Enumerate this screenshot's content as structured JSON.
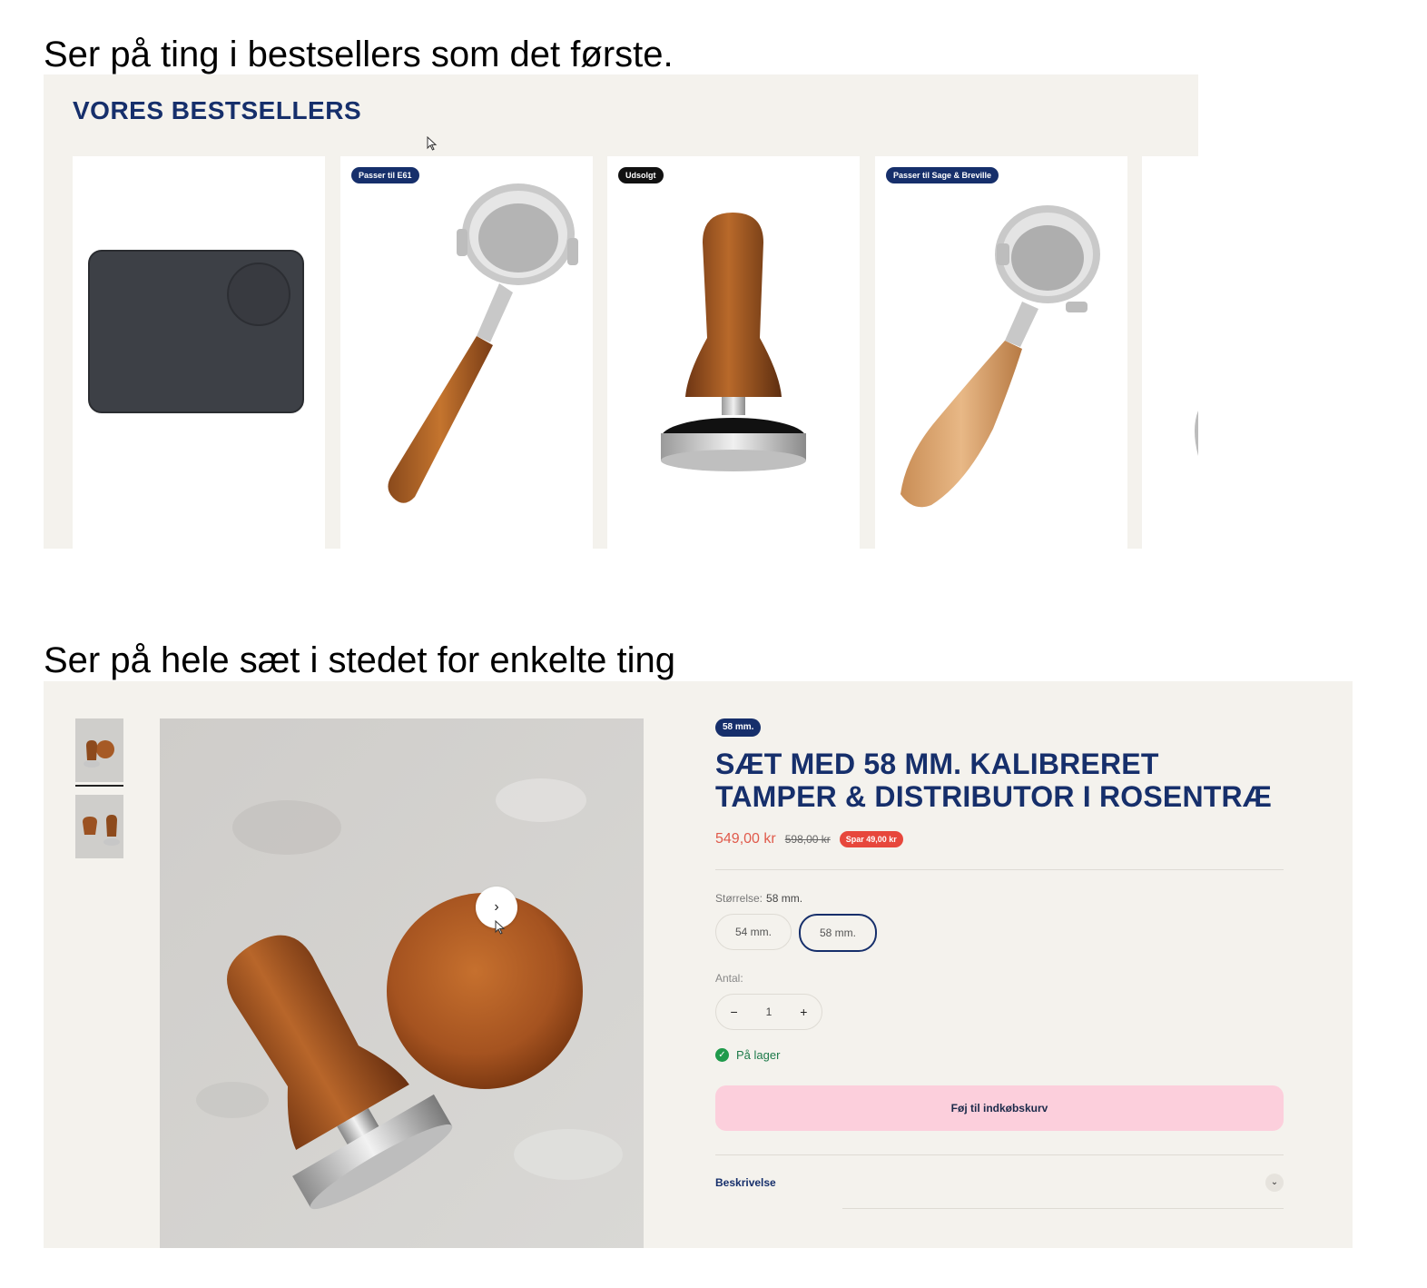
{
  "captions": {
    "first": "Ser på ting i bestsellers som det første.",
    "second": "Ser på hele sæt i stedet for enkelte ting"
  },
  "bestsellers": {
    "title": "VORES BESTSELLERS",
    "cards": [
      {
        "badge": "",
        "image": "tamper-mat"
      },
      {
        "badge": "Passer til E61",
        "image": "portafilter-rosewood"
      },
      {
        "badge": "Udsolgt",
        "image": "tamper-rosewood"
      },
      {
        "badge": "Passer til Sage & Breville",
        "image": "portafilter-beech"
      },
      {
        "badge": "",
        "image": "partial-product"
      }
    ]
  },
  "product": {
    "size_pill": "58 mm.",
    "title": "SÆT MED 58 MM. KALIBRERET TAMPER & DISTRIBUTOR I ROSENTRÆ",
    "price": "549,00 kr",
    "old_price": "598,00 kr",
    "save_badge": "Spar 49,00 kr",
    "size_label": "Størrelse:",
    "size_selected": "58 mm.",
    "size_options": [
      "54 mm.",
      "58 mm."
    ],
    "qty_label": "Antal:",
    "qty_minus": "−",
    "qty_value": "1",
    "qty_plus": "+",
    "stock": "På lager",
    "stock_icon": "check-icon",
    "add_to_cart": "Føj til indkøbskurv",
    "description": "Beskrivelse",
    "gallery_next": "›"
  },
  "colors": {
    "navy": "#162f6b",
    "page_bg": "#f4f2ed",
    "price_red": "#e05a4b",
    "save_red": "#e7473c",
    "cart_pink": "#fccfdc",
    "stock_green": "#1f9a4b"
  }
}
